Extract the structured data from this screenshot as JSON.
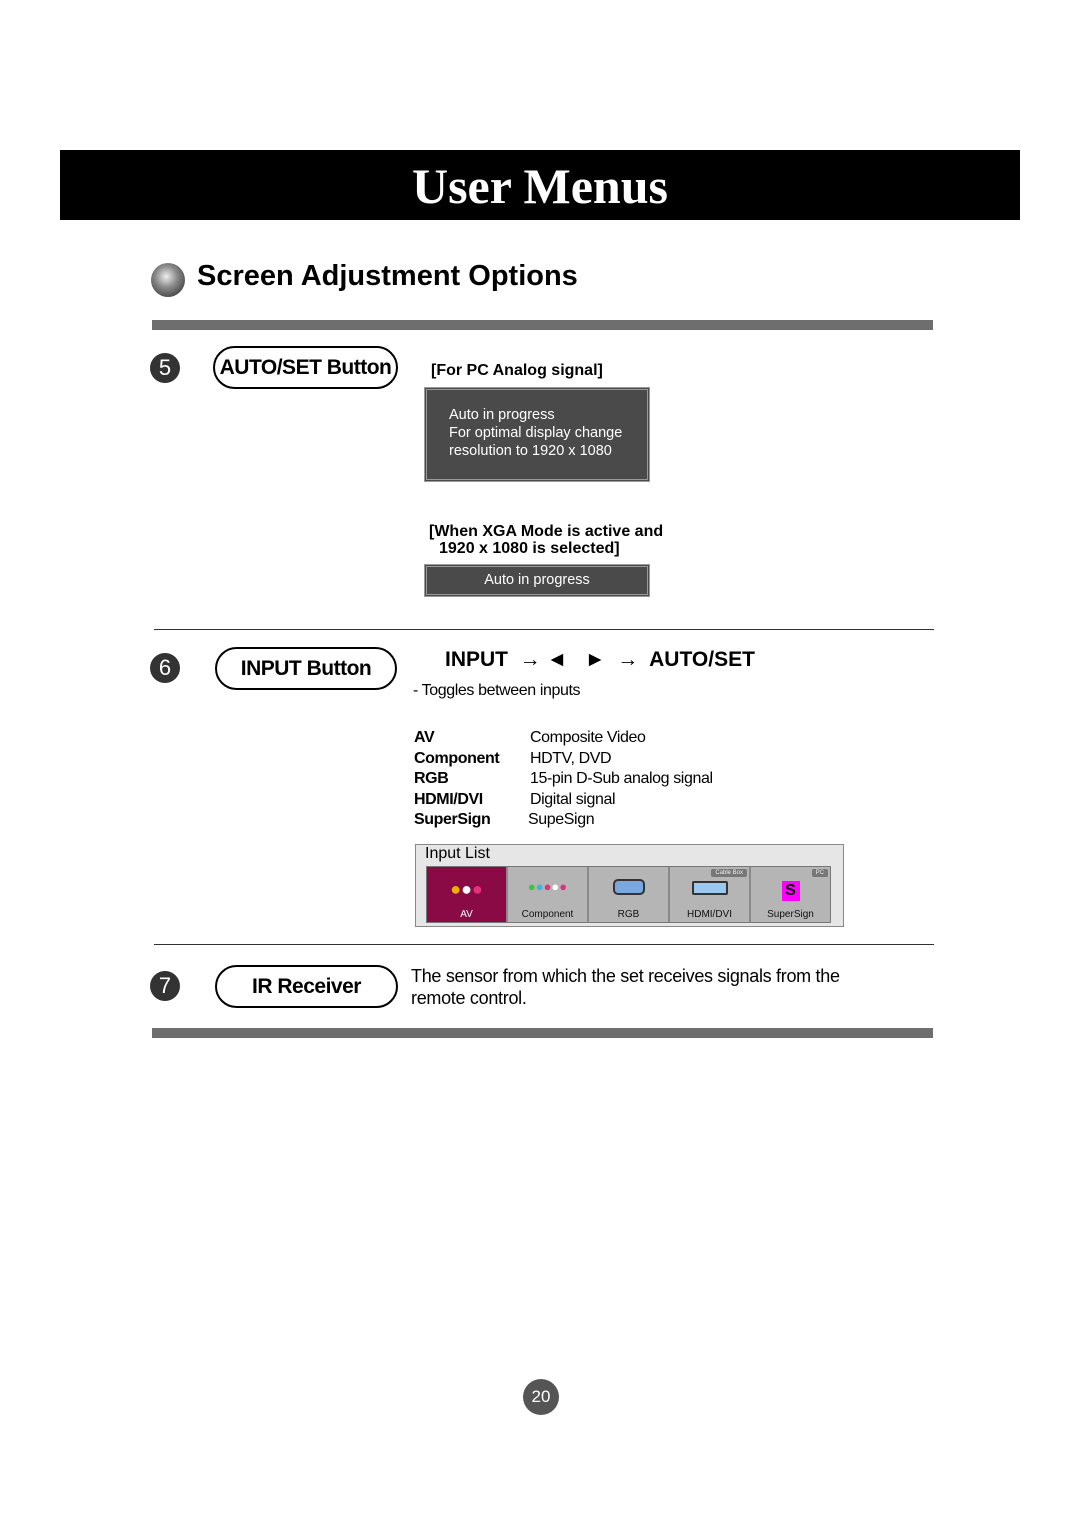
{
  "banner": {
    "title": "User Menus"
  },
  "section": {
    "title": "Screen Adjustment Options"
  },
  "items": [
    {
      "number": "5",
      "button": "AUTO/SET Button"
    },
    {
      "number": "6",
      "button": "INPUT Button"
    },
    {
      "number": "7",
      "button": "IR Receiver"
    }
  ],
  "autoset": {
    "pc_label": "[For PC Analog signal]",
    "osd1": [
      "Auto in progress",
      "For optimal display change",
      "resolution to 1920 x 1080"
    ],
    "xga_label1": "[When XGA Mode is active and",
    "xga_label2": "1920 x 1080 is selected]",
    "osd2": "Auto in progress"
  },
  "input": {
    "sequence": "INPUT  → ◄   ►  →  AUTO/SET",
    "toggle_note": "- Toggles between inputs",
    "table": [
      {
        "name": "AV",
        "desc": "Composite Video"
      },
      {
        "name": "Component",
        "desc": "HDTV, DVD"
      },
      {
        "name": "RGB",
        "desc": "15-pin D-Sub analog signal"
      },
      {
        "name": "HDMI/DVI",
        "desc": "Digital signal"
      },
      {
        "name": "SuperSign",
        "desc": "SupeSign"
      }
    ],
    "list_title": "Input List",
    "tiles": [
      {
        "label": "AV",
        "selected": true,
        "icon": "rca-3-icon"
      },
      {
        "label": "Component",
        "icon": "rca-5-icon"
      },
      {
        "label": "RGB",
        "icon": "dsub-icon"
      },
      {
        "label": "HDMI/DVI",
        "tag": "Cable Box",
        "icon": "hdmi-icon"
      },
      {
        "label": "SuperSign",
        "tag": "PC",
        "icon": "supersign-icon"
      }
    ],
    "selected_color": "#8a0a45"
  },
  "ir": {
    "text1": "The sensor from which the set receives signals from the",
    "text2": "remote control."
  },
  "page_number": "20"
}
